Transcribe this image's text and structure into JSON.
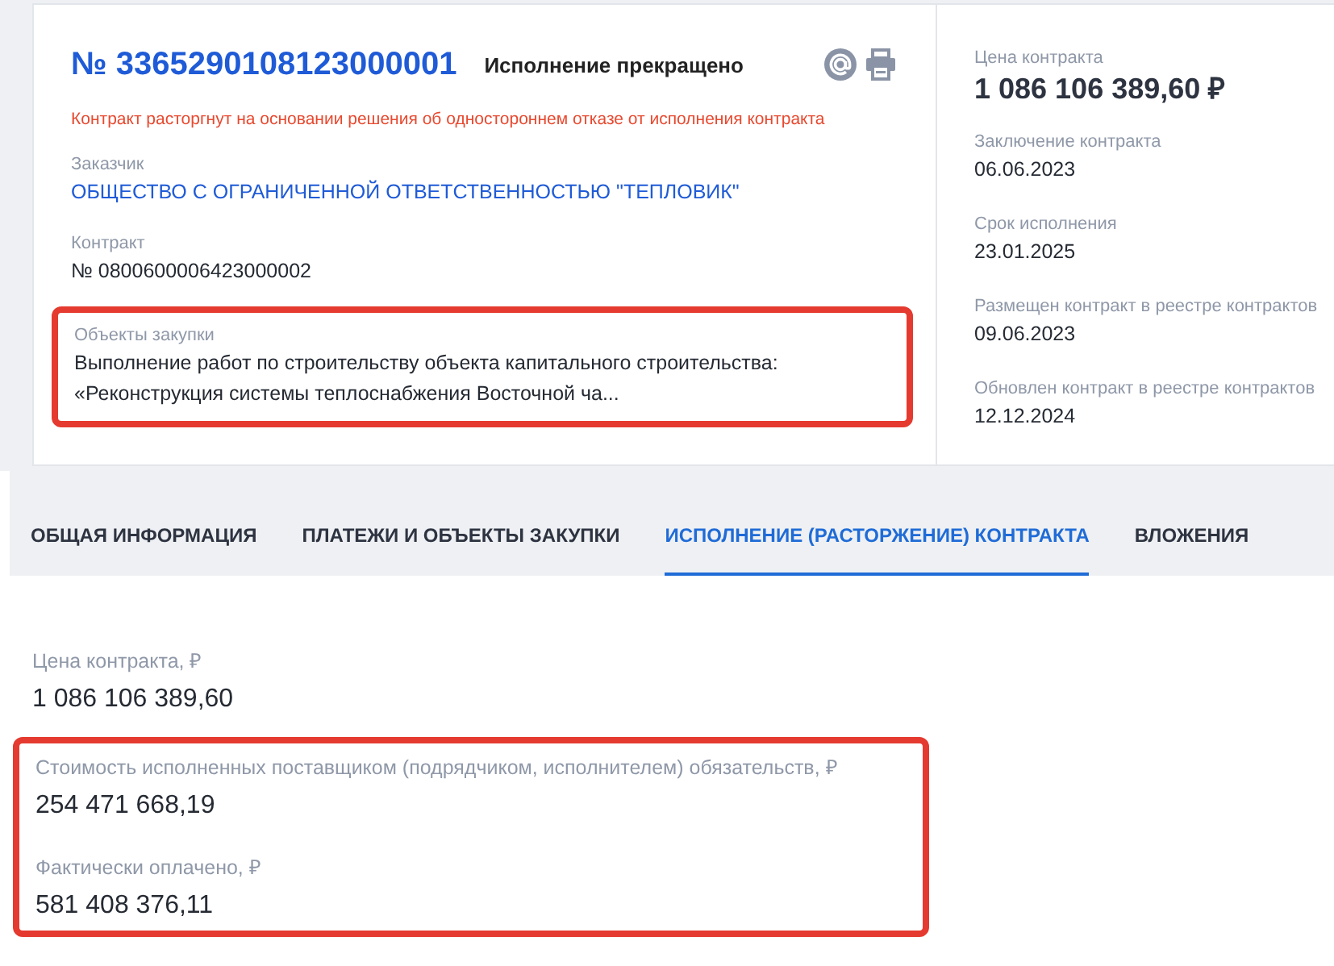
{
  "header": {
    "number": "№ 3365290108123000001",
    "status": "Исполнение прекращено",
    "notice": "Контракт расторгнут на основании решения об одностороннем отказе от исполнения контракта"
  },
  "left_fields": [
    {
      "label": "Заказчик",
      "value": "ОБЩЕСТВО С ОГРАНИЧЕННОЙ ОТВЕТСТВЕННОСТЬЮ \"ТЕПЛОВИК\"",
      "kind": "link",
      "highlighted": false
    },
    {
      "label": "Контракт",
      "value": "№ 0800600006423000002",
      "kind": "text",
      "highlighted": false
    },
    {
      "label": "Объекты закупки",
      "value": "Выполнение работ по строительству объекта капитального строительства: «Реконструкция системы теплоснабжения Восточной ча...",
      "kind": "text",
      "highlighted": true
    }
  ],
  "right_fields": [
    {
      "label": "Цена контракта",
      "value": "1 086 106 389,60 ₽",
      "kind": "price"
    },
    {
      "label": "Заключение контракта",
      "value": "06.06.2023",
      "kind": "text"
    },
    {
      "label": "Срок исполнения",
      "value": "23.01.2025",
      "kind": "text"
    },
    {
      "label": "Размещен контракт в реестре контрактов",
      "value": "09.06.2023",
      "kind": "text"
    },
    {
      "label": "Обновлен контракт в реестре контрактов",
      "value": "12.12.2024",
      "kind": "text"
    }
  ],
  "tabs": [
    {
      "label": "ОБЩАЯ ИНФОРМАЦИЯ",
      "selected": false
    },
    {
      "label": "ПЛАТЕЖИ И ОБЪЕКТЫ ЗАКУПКИ",
      "selected": false
    },
    {
      "label": "ИСПОЛНЕНИЕ (РАСТОРЖЕНИЕ) КОНТРАКТА",
      "selected": true
    },
    {
      "label": "ВЛОЖЕНИЯ",
      "selected": false
    }
  ],
  "execution_fields": [
    {
      "label": "Цена контракта, ₽",
      "value": "1 086 106 389,60",
      "highlighted": false
    },
    {
      "label": "Стоимость исполненных поставщиком (подрядчиком, исполнителем) обязательств, ₽",
      "value": "254 471 668,19",
      "highlighted": true
    },
    {
      "label": "Фактически оплачено, ₽",
      "value": "581 408 376,11",
      "highlighted": true
    }
  ]
}
